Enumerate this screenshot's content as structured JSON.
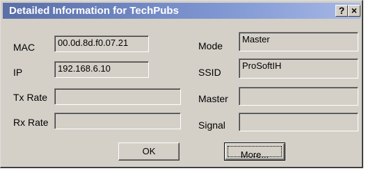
{
  "window": {
    "title": "Detailed Information for TechPubs",
    "help_label": "?",
    "close_label": "×"
  },
  "left_fields": [
    {
      "label": "MAC",
      "value": "00.0d.8d.f0.07.21"
    },
    {
      "label": "IP",
      "value": "192.168.6.10"
    },
    {
      "label": "Tx Rate",
      "value": ""
    },
    {
      "label": "Rx Rate",
      "value": ""
    }
  ],
  "right_fields": [
    {
      "label": "Mode",
      "value": "Master"
    },
    {
      "label": "SSID",
      "value": "ProSoftIH"
    },
    {
      "label": "Master",
      "value": ""
    },
    {
      "label": "Signal",
      "value": ""
    }
  ],
  "buttons": {
    "ok_label": "OK",
    "more_label": "More..."
  }
}
